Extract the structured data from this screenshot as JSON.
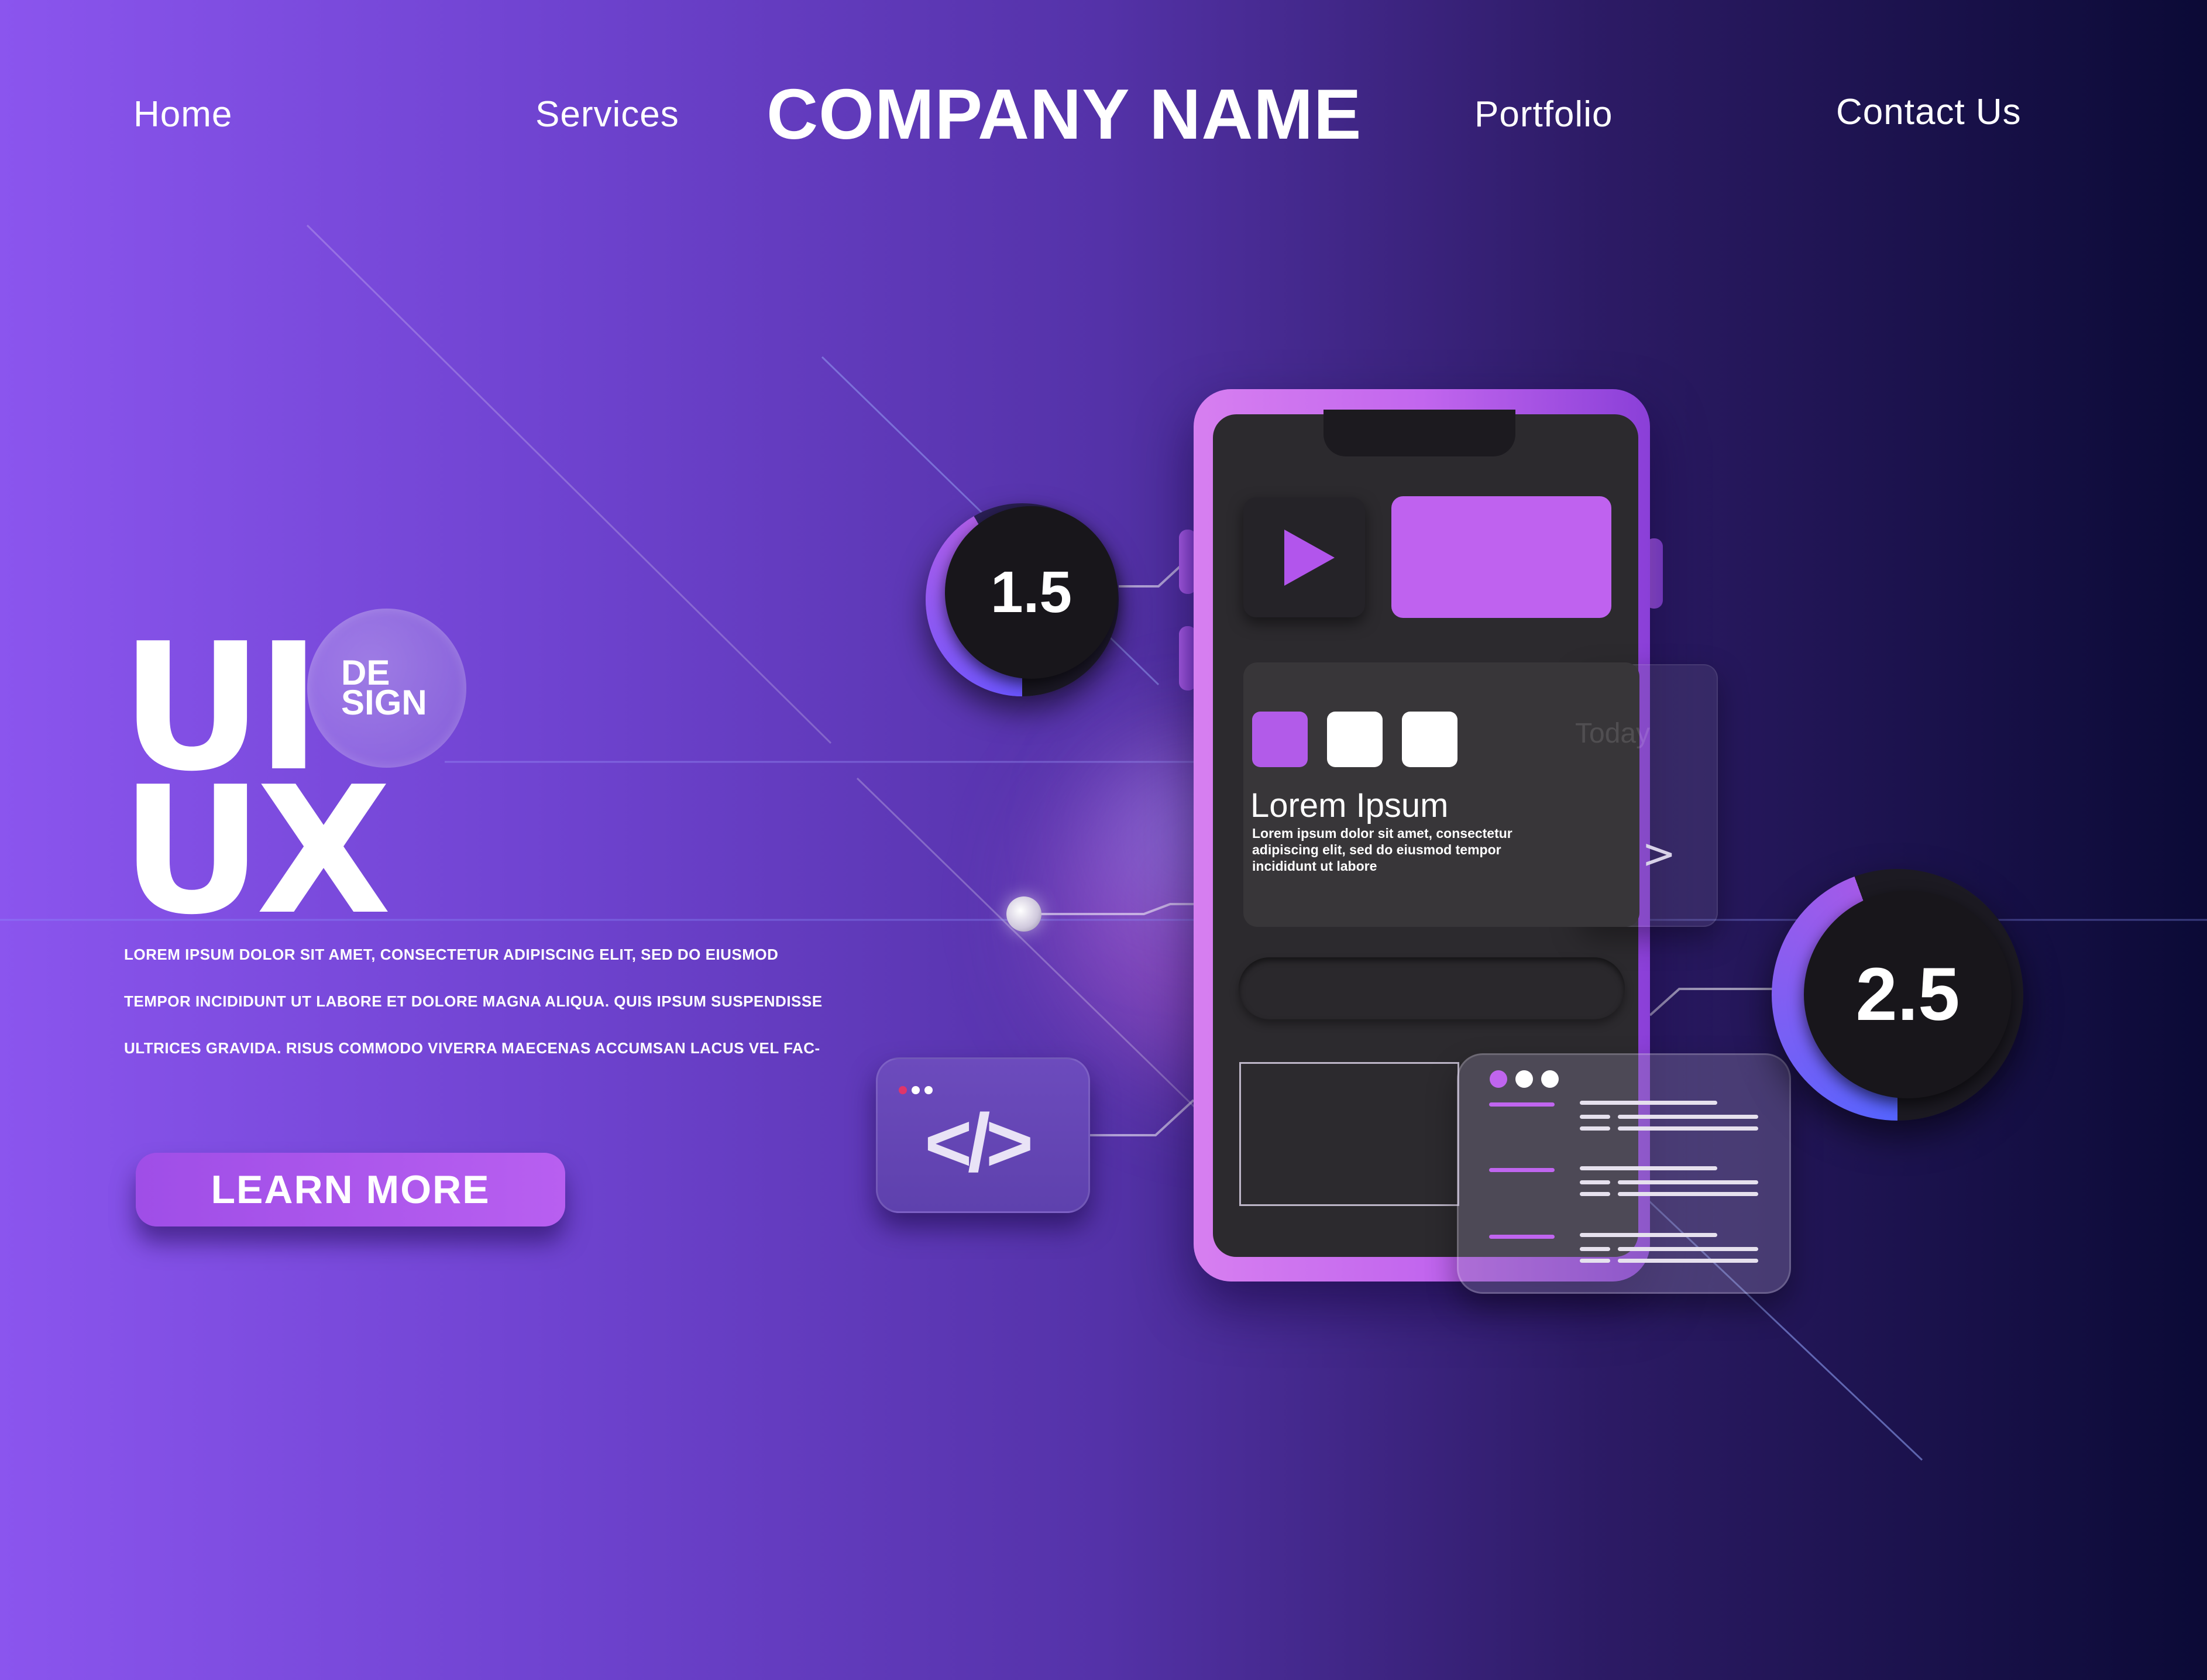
{
  "nav": {
    "home": "Home",
    "services": "Services",
    "company_name": "COMPANY NAME",
    "portfolio": "Portfolio",
    "contact": "Contact Us"
  },
  "hero": {
    "ui": "UI",
    "ux": "UX",
    "design_line1": "DE",
    "design_line2": "SIGN",
    "description_lines": [
      "LOREM IPSUM DOLOR SIT AMET, CONSECTETUR ADIPISCING ELIT, SED DO EIUSMOD",
      "TEMPOR INCIDIDUNT UT LABORE ET DOLORE MAGNA ALIQUA. QUIS IPSUM SUSPENDISSE",
      "ULTRICES GRAVIDA. RISUS COMMODO VIVERRA MAECENAS ACCUMSAN LACUS VEL FAC-"
    ],
    "cta_label": "LEARN MORE"
  },
  "phone": {
    "card_title": "Lorem Ipsum",
    "card_body": "Lorem ipsum dolor sit amet, consectetur adipiscing elit, sed do eiusmod tempor incididunt ut labore",
    "today_label": "Today",
    "chevron": ">"
  },
  "code_card": {
    "symbol": "</>"
  },
  "rings": {
    "left_value": "1.5",
    "right_value": "2.5"
  },
  "colors": {
    "accent_purple": "#bf62ef",
    "ring_blue": "#5b6cff",
    "screen_dark": "#2c2a2e"
  },
  "icons": [
    "play-icon",
    "code-icon",
    "chevron-right-icon",
    "window-dots-icon"
  ]
}
